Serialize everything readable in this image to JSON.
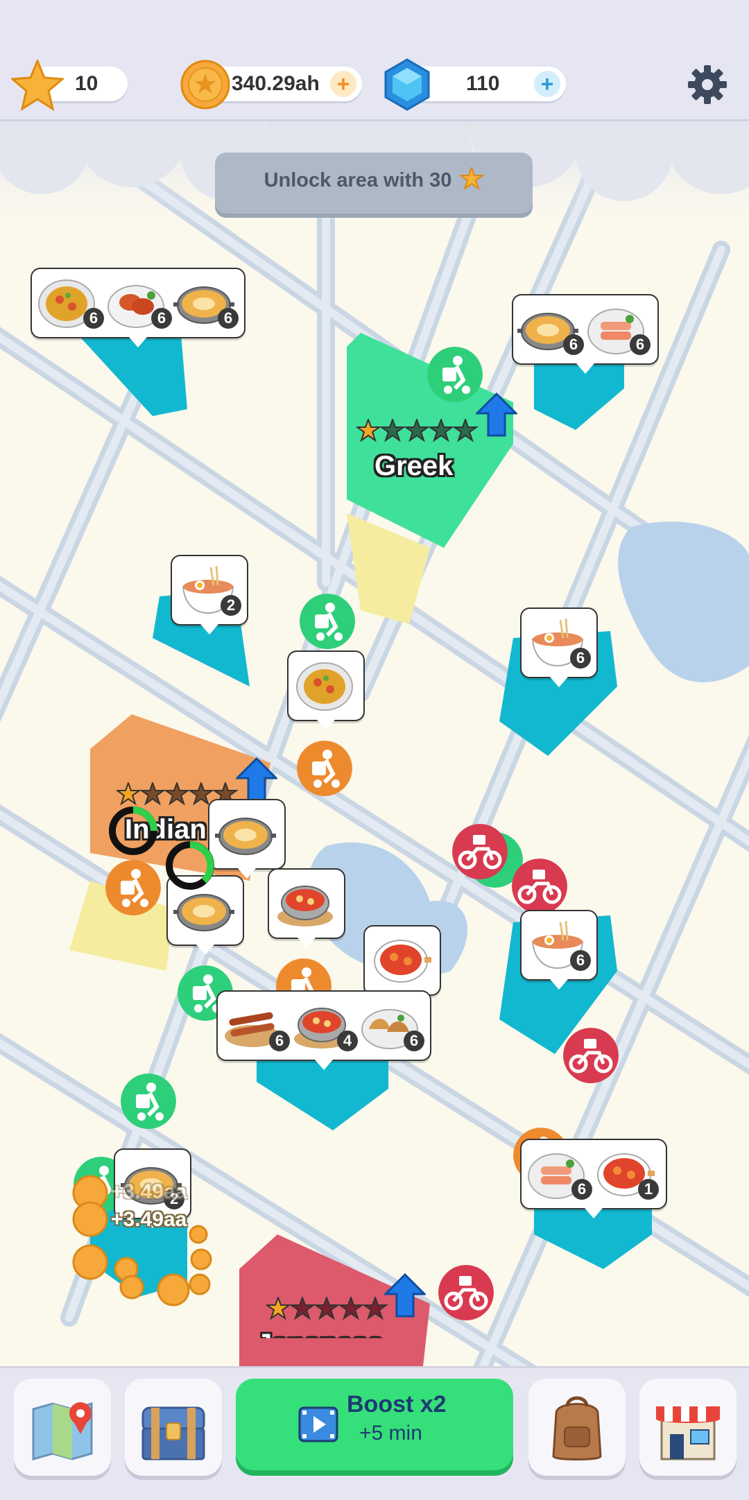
{
  "hud": {
    "stars": "10",
    "coins": "340.29ah",
    "gems": "110",
    "plus_symbol": "+"
  },
  "banner": {
    "text": "Unlock area with 30"
  },
  "restaurants": {
    "greek": {
      "name": "Greek",
      "stars_filled": 1,
      "stars_total": 5
    },
    "indian": {
      "name": "Indian",
      "stars_filled": 1,
      "stars_total": 5
    },
    "japanese": {
      "name": "Japanese",
      "stars_filled": 1,
      "stars_total": 5
    }
  },
  "orders": [
    {
      "dishes": [
        "paella",
        "chicken-kebab",
        "curry-pan"
      ],
      "counts": [
        "6",
        "6",
        "6"
      ]
    },
    {
      "dishes": [
        "curry-pan",
        "salmon"
      ],
      "counts": [
        "6",
        "6"
      ]
    },
    {
      "dishes": [
        "ramen"
      ],
      "counts": [
        "2"
      ]
    },
    {
      "dishes": [
        "paella"
      ],
      "counts": []
    },
    {
      "dishes": [
        "ramen"
      ],
      "counts": [
        "6"
      ]
    },
    {
      "dishes": [
        "curry-pan"
      ],
      "counts": []
    },
    {
      "dishes": [
        "curry-pan"
      ],
      "counts": []
    },
    {
      "dishes": [
        "tomato-stew"
      ],
      "counts": []
    },
    {
      "dishes": [
        "tomato-stew"
      ],
      "counts": []
    },
    {
      "dishes": [
        "ramen"
      ],
      "counts": [
        "6"
      ]
    },
    {
      "dishes": [
        "skewers",
        "tomato-stew",
        "dumplings"
      ],
      "counts": [
        "6",
        "4",
        "6"
      ]
    },
    {
      "dishes": [
        "curry-pan"
      ],
      "counts": [
        "2"
      ]
    },
    {
      "dishes": [
        "salmon",
        "tomato-stew"
      ],
      "counts": [
        "6",
        "1"
      ]
    }
  ],
  "floating_rewards": [
    "+3.49aa",
    "+3.49aa"
  ],
  "bottom_bar": {
    "boost_label": "Boost x2",
    "boost_sub": "+5 min",
    "tabs": [
      "map-icon",
      "chest-icon",
      "boost-button",
      "backpack-icon",
      "shop-icon"
    ]
  },
  "colors": {
    "greek_zone": "#3fe09a",
    "indian_zone": "#f0a060",
    "japanese_zone": "#dc5a6c",
    "delivery_zone": "#12b8cf",
    "courier_green": "#2ecf7a",
    "courier_orange": "#ee8a2e",
    "courier_red": "#d83a50",
    "boost_green": "#35e07a"
  }
}
